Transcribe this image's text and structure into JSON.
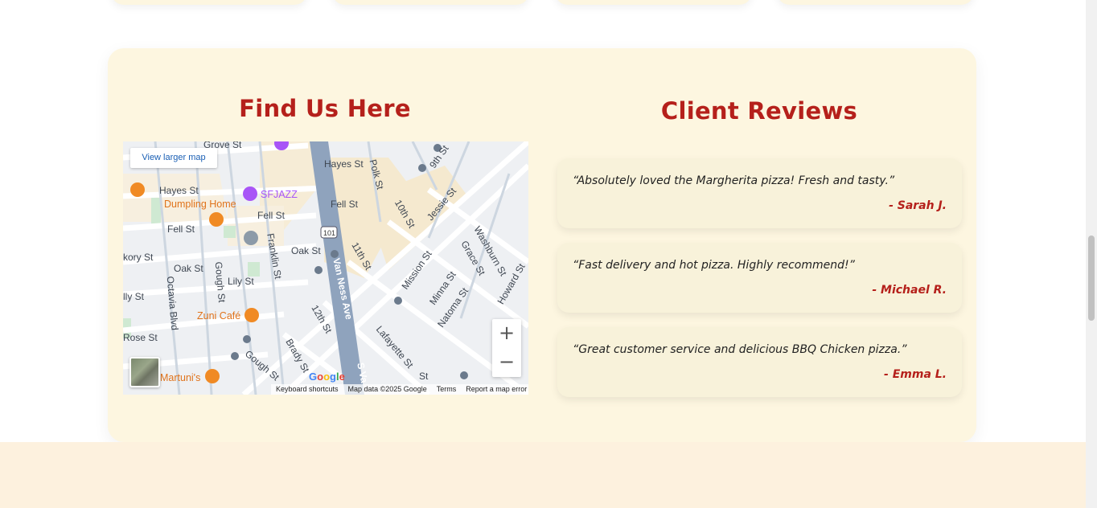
{
  "find_us": {
    "title": "Find Us Here",
    "map": {
      "larger_map_label": "View larger map",
      "zoom_in": "+",
      "zoom_out": "−",
      "attribution": {
        "keyboard": "Keyboard shortcuts",
        "map_data": "Map data ©2025 Google",
        "terms": "Terms",
        "report": "Report a map error"
      },
      "google_logo": "Google",
      "labels": {
        "hayes_st_1": "Hayes St",
        "hayes_st_2": "Hayes St",
        "grove_st": "Grove St",
        "sfjazz": "SFJAZZ",
        "dumpling_home": "Dumpling Home",
        "fell_st_1": "Fell St",
        "fell_st_2": "Fell St",
        "fell_st_3": "Fell St",
        "polk_st": "Polk St",
        "ninth_st": "9th St",
        "tenth_st": "10th St",
        "jessie_st": "Jessie St",
        "oak_st_1": "Oak St",
        "oak_st_2": "Oak St",
        "hickory_st": "kory St",
        "franklin_st": "Franklin St",
        "lily_st": "Lily St",
        "gough_st": "Gough St",
        "octavia_blvd": "Octavia Blvd",
        "eleventh_st": "11th St",
        "mission_st": "Mission St",
        "van_ness_ave": "Van Ness Ave",
        "washburn_st": "Washburn St",
        "grace_st": "Grace St",
        "minna_st": "Minna St",
        "natoma_st": "Natoma St",
        "howard_st": "Howard St",
        "zuni_cafe": "Zuni Café",
        "twelfth_st": "12th St",
        "lafayette_st": "Lafayette St",
        "brady_st": "Brady St",
        "rose_st": "Rose St",
        "martunis": "Martuni's",
        "gough_st_2": "Gough St",
        "route_101": "101",
        "s_van": "S Va",
        "lly_st": "lly St",
        "st_partial": "St"
      }
    }
  },
  "reviews": {
    "title": "Client Reviews",
    "items": [
      {
        "text": "“Absolutely loved the Margherita pizza! Fresh and tasty.”",
        "author": "- Sarah J."
      },
      {
        "text": "“Fast delivery and hot pizza. Highly recommend!”",
        "author": "- Michael R."
      },
      {
        "text": "“Great customer service and delicious BBQ Chicken pizza.”",
        "author": "- Emma L."
      }
    ]
  },
  "colors": {
    "accent": "#b5201b",
    "section_bg": "#fdf6e0",
    "review_bg": "#f8f2da"
  }
}
